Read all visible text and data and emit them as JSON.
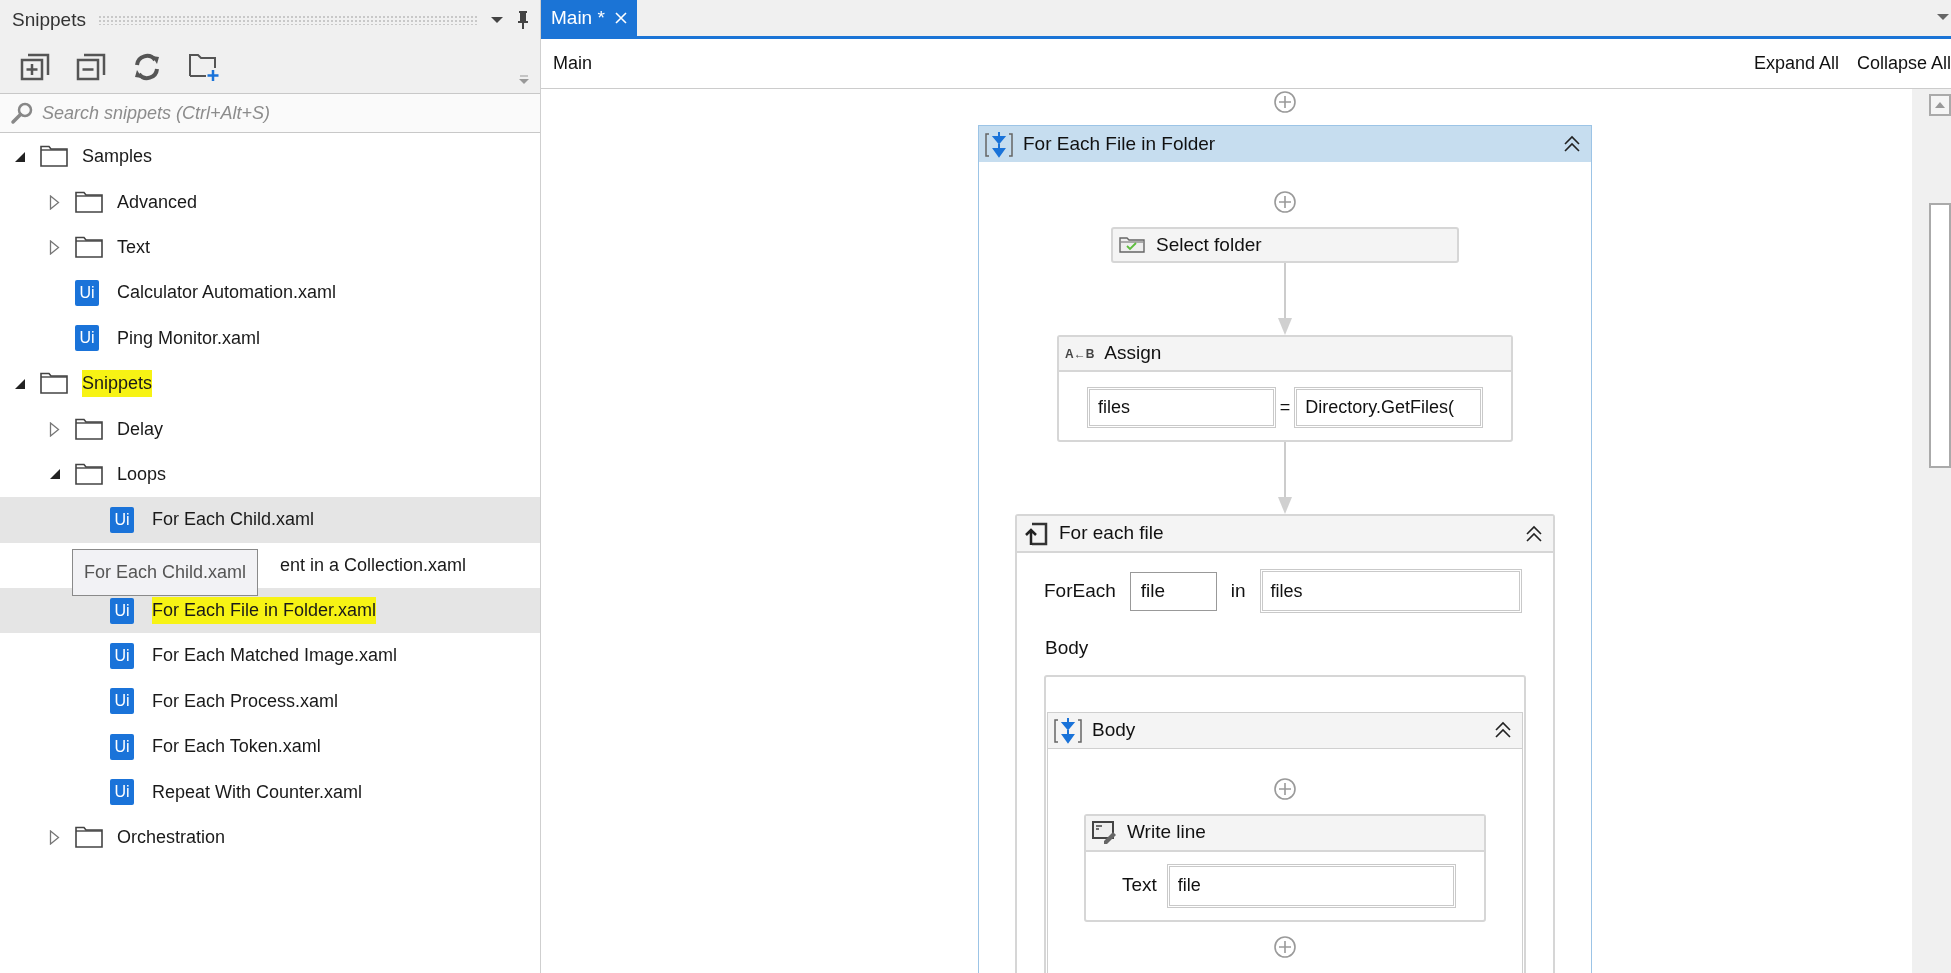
{
  "snippets_panel": {
    "title": "Snippets",
    "search": {
      "placeholder": "Search snippets (Ctrl+Alt+S)"
    },
    "tree": [
      {
        "kind": "folder",
        "label": "Samples",
        "expanded": true,
        "selected": false,
        "marker": false,
        "children": [
          {
            "kind": "folder",
            "label": "Advanced",
            "expanded": false,
            "selected": false,
            "marker": false
          },
          {
            "kind": "folder",
            "label": "Text",
            "expanded": false,
            "selected": false,
            "marker": false
          },
          {
            "kind": "file",
            "icon_label": "Ui",
            "label": "Calculator Automation.xaml",
            "selected": false,
            "marker": false
          },
          {
            "kind": "file",
            "icon_label": "Ui",
            "label": "Ping Monitor.xaml",
            "selected": false,
            "marker": false
          }
        ]
      },
      {
        "kind": "folder",
        "label": "Snippets",
        "expanded": true,
        "selected": false,
        "marker": true,
        "children": [
          {
            "kind": "folder",
            "label": "Delay",
            "expanded": false,
            "selected": false,
            "marker": false
          },
          {
            "kind": "folder",
            "label": "Loops",
            "expanded": true,
            "selected": false,
            "marker": false,
            "children": [
              {
                "kind": "file",
                "icon_label": "Ui",
                "label": "For Each Child.xaml",
                "selected": true,
                "marker": false
              },
              {
                "kind": "covered",
                "label": "ent in a Collection.xaml",
                "selected": false,
                "marker": false
              },
              {
                "kind": "file",
                "icon_label": "Ui",
                "label": "For Each File in Folder.xaml",
                "selected": true,
                "marker": true
              },
              {
                "kind": "file",
                "icon_label": "Ui",
                "label": "For Each Matched Image.xaml",
                "selected": false,
                "marker": false
              },
              {
                "kind": "file",
                "icon_label": "Ui",
                "label": "For Each Process.xaml",
                "selected": false,
                "marker": false
              },
              {
                "kind": "file",
                "icon_label": "Ui",
                "label": "For Each Token.xaml",
                "selected": false,
                "marker": false
              },
              {
                "kind": "file",
                "icon_label": "Ui",
                "label": "Repeat With Counter.xaml",
                "selected": false,
                "marker": false
              }
            ]
          },
          {
            "kind": "folder",
            "label": "Orchestration",
            "expanded": false,
            "selected": false,
            "marker": false
          }
        ]
      }
    ],
    "tooltip": "For Each Child.xaml"
  },
  "designer": {
    "tabs": [
      {
        "label": "Main *",
        "selected": true
      }
    ],
    "breadcrumb": "Main",
    "expand_all": "Expand All",
    "collapse_all": "Collapse All",
    "workflow": {
      "kind": "sequence",
      "title": "For Each File in Folder",
      "selected": true,
      "children": [
        {
          "kind": "select_folder",
          "title": "Select folder"
        },
        {
          "kind": "assign",
          "icon_label": "A←B",
          "title": "Assign",
          "to": "files",
          "equals": "=",
          "value": "Directory.GetFiles("
        },
        {
          "kind": "foreach",
          "title": "For each file",
          "foreach_label": "ForEach",
          "item": "file",
          "in_label": "in",
          "values": "files",
          "body_label": "Body",
          "body": {
            "kind": "sequence",
            "title": "Body",
            "selected": false,
            "children": [
              {
                "kind": "writeline",
                "title": "Write line",
                "text_label": "Text",
                "text": "file"
              }
            ]
          }
        }
      ]
    }
  }
}
